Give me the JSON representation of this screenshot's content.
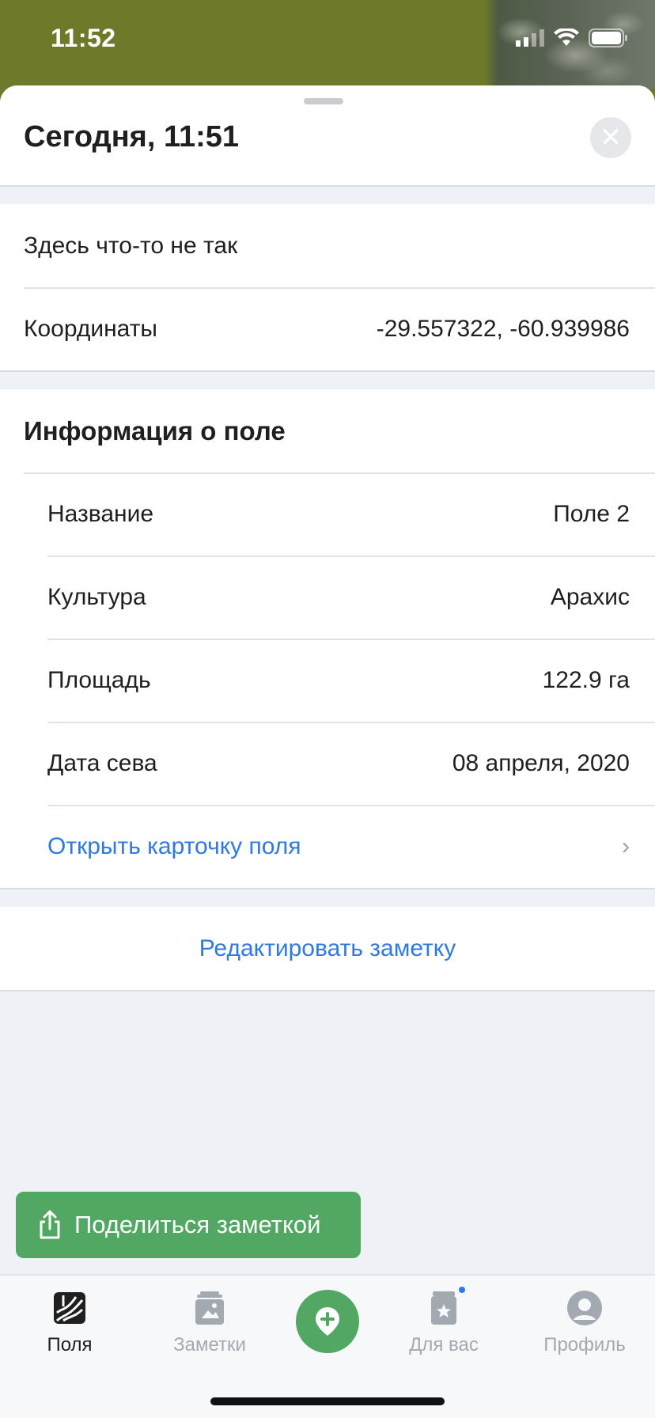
{
  "status_bar": {
    "time": "11:52"
  },
  "header": {
    "title": "Сегодня, 11:51",
    "close_icon": "close-icon"
  },
  "note": {
    "text": "Здесь что-то не так",
    "coordinates_label": "Координаты",
    "coordinates_value": "-29.557322, -60.939986"
  },
  "field_info": {
    "title": "Информация о поле",
    "rows": [
      {
        "label": "Название",
        "value": "Поле 2"
      },
      {
        "label": "Культура",
        "value": "Арахис"
      },
      {
        "label": "Площадь",
        "value": "122.9 га"
      },
      {
        "label": "Дата сева",
        "value": "08 апреля, 2020"
      }
    ],
    "open_card_label": "Открыть карточку поля"
  },
  "edit_note_label": "Редактировать заметку",
  "share_button_label": "Поделиться заметкой",
  "tabs": [
    {
      "label": "Поля",
      "icon": "fields-icon",
      "active": true
    },
    {
      "label": "Заметки",
      "icon": "notes-icon",
      "active": false
    },
    {
      "label": "",
      "icon": "add-note-icon",
      "active": false
    },
    {
      "label": "Для вас",
      "icon": "for-you-icon",
      "active": false,
      "badge": true
    },
    {
      "label": "Профиль",
      "icon": "profile-icon",
      "active": false
    }
  ],
  "colors": {
    "accent_green": "#52a862",
    "link_blue": "#2f7ae0",
    "map_olive": "#6e7a2a"
  }
}
